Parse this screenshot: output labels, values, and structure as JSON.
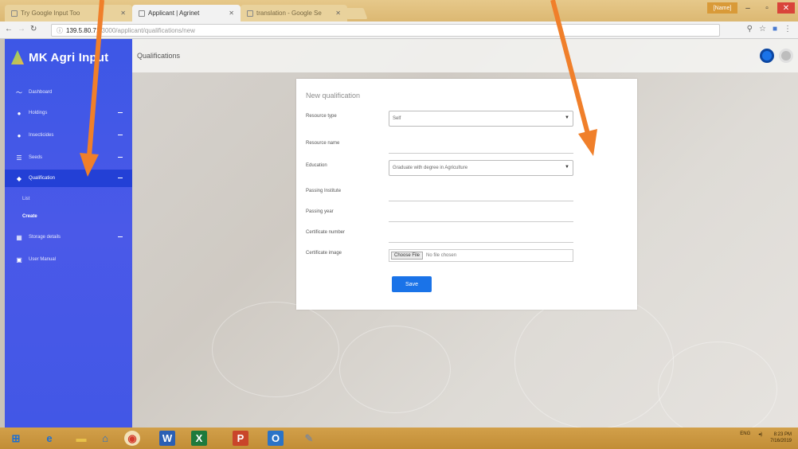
{
  "browser": {
    "tabs": [
      {
        "label": "Try Google Input Too",
        "active": false
      },
      {
        "label": "Applicant | Agrinet",
        "active": true
      },
      {
        "label": "translation - Google Se",
        "active": false
      }
    ],
    "user_badge": "[Name]",
    "url_host": "139.5.80.71",
    "url_path": ":3000/applicant/qualifications/new"
  },
  "app": {
    "brand": "MK Agri Input",
    "page_title": "Qualifications"
  },
  "sidebar": {
    "items": [
      {
        "label": "Dashboard",
        "icon": "chart-icon",
        "expandable": false
      },
      {
        "label": "Holdings",
        "icon": "person-icon",
        "expandable": true
      },
      {
        "label": "Insecticides",
        "icon": "person-icon",
        "expandable": true
      },
      {
        "label": "Seeds",
        "icon": "list-icon",
        "expandable": true
      },
      {
        "label": "Qualification",
        "icon": "graduation-cap-icon",
        "expandable": true,
        "active": true
      },
      {
        "label": "Storage details",
        "icon": "building-icon",
        "expandable": true
      },
      {
        "label": "User Manual",
        "icon": "document-icon",
        "expandable": false
      }
    ],
    "subitems": [
      "List",
      "Create"
    ]
  },
  "form": {
    "heading": "New qualification",
    "fields": [
      {
        "label": "Resource type",
        "value": "Self",
        "type": "select"
      },
      {
        "label": "Resource name",
        "value": "",
        "type": "text"
      },
      {
        "label": "Education",
        "value": "Graduate with degree in Agriculture",
        "type": "select"
      },
      {
        "label": "Passing Institute",
        "value": "",
        "type": "text"
      },
      {
        "label": "Passing year",
        "value": "",
        "type": "text"
      },
      {
        "label": "Certificate number",
        "value": "",
        "type": "text"
      },
      {
        "label": "Certificate image",
        "value": "No file chosen",
        "type": "file",
        "button": "Choose File"
      }
    ],
    "save_label": "Save"
  },
  "taskbar": {
    "language": "ENG",
    "time": "8:23 PM",
    "date": "7/16/2019"
  },
  "colors": {
    "sidebar": "#4257e6",
    "primary": "#1a73e8",
    "annotation_arrow": "#f07f2a"
  }
}
